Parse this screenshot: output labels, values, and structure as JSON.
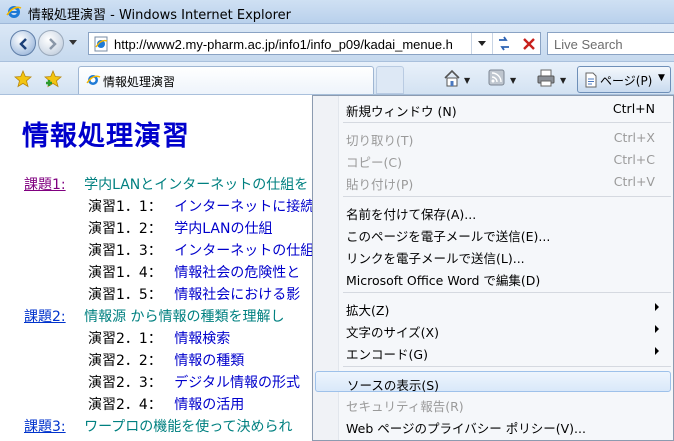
{
  "window": {
    "title": "情報処理演習 - Windows Internet Explorer"
  },
  "address_bar": {
    "url": "http://www2.my-pharm.ac.jp/info1/info_p09/kadai_menue.h",
    "search_placeholder": "Live Search"
  },
  "tab": {
    "label": "情報処理演習"
  },
  "command_bar": {
    "page_label": "ページ(P)"
  },
  "page": {
    "title": "情報処理演習",
    "rows": [
      {
        "kadai": "課題1:",
        "desc": "学内LANとインターネットの仕組を"
      },
      {
        "ensyu": "演習1．1：",
        "link": "インターネットに接続"
      },
      {
        "ensyu": "演習1．2：",
        "link": "学内LANの仕組"
      },
      {
        "ensyu": "演習1．3：",
        "link": "インターネットの仕組"
      },
      {
        "ensyu": "演習1．4：",
        "link": "情報社会の危険性と"
      },
      {
        "ensyu": "演習1．5：",
        "link": "情報社会における影"
      },
      {
        "kadai": "課題2:",
        "desc": "情報源 から情報の種類を理解し"
      },
      {
        "ensyu": "演習2．1：",
        "link": "情報検索"
      },
      {
        "ensyu": "演習2．2：",
        "link": "情報の種類"
      },
      {
        "ensyu": "演習2．3：",
        "link": "デジタル情報の形式"
      },
      {
        "ensyu": "演習2．4：",
        "link": "情報の活用"
      },
      {
        "kadai": "課題3:",
        "desc": "ワープロの機能を使って決められ"
      }
    ]
  },
  "page_menu": {
    "items": [
      {
        "label": "新規ウィンドウ (N)",
        "shortcut": "Ctrl+N",
        "disabled": false
      },
      {
        "label": "切り取り(T)",
        "shortcut": "Ctrl+X",
        "disabled": true
      },
      {
        "label": "コピー(C)",
        "shortcut": "Ctrl+C",
        "disabled": true
      },
      {
        "label": "貼り付け(P)",
        "shortcut": "Ctrl+V",
        "disabled": true
      },
      {
        "label": "名前を付けて保存(A)...",
        "shortcut": "",
        "disabled": false
      },
      {
        "label": "このページを電子メールで送信(E)...",
        "shortcut": "",
        "disabled": false
      },
      {
        "label": "リンクを電子メールで送信(L)...",
        "shortcut": "",
        "disabled": false
      },
      {
        "label": "Microsoft Office Word で編集(D)",
        "shortcut": "",
        "disabled": false
      },
      {
        "label": "拡大(Z)",
        "shortcut": "",
        "disabled": false,
        "submenu": true
      },
      {
        "label": "文字のサイズ(X)",
        "shortcut": "",
        "disabled": false,
        "submenu": true
      },
      {
        "label": "エンコード(G)",
        "shortcut": "",
        "disabled": false,
        "submenu": true
      },
      {
        "label": "ソースの表示(S)",
        "shortcut": "",
        "disabled": false,
        "highlighted": true
      },
      {
        "label": "セキュリティ報告(R)",
        "shortcut": "",
        "disabled": true
      },
      {
        "label": "Web ページのプライバシー ポリシー(V)...",
        "shortcut": "",
        "disabled": false
      }
    ]
  },
  "icons": {
    "browser": "ie-icon",
    "back": "back-arrow-icon",
    "forward": "forward-arrow-icon",
    "refresh": "refresh-icon",
    "stop": "stop-icon",
    "favorites": "favorites-star-icon",
    "add_favorite": "add-favorite-icon",
    "home": "home-icon",
    "feeds": "feeds-icon",
    "print": "print-icon",
    "page": "page-icon"
  },
  "colors": {
    "title_blue": "#0000cc",
    "kadai_visited": "#800080",
    "desc_teal": "#008080",
    "menu_highlight": "#d9e8f9"
  }
}
